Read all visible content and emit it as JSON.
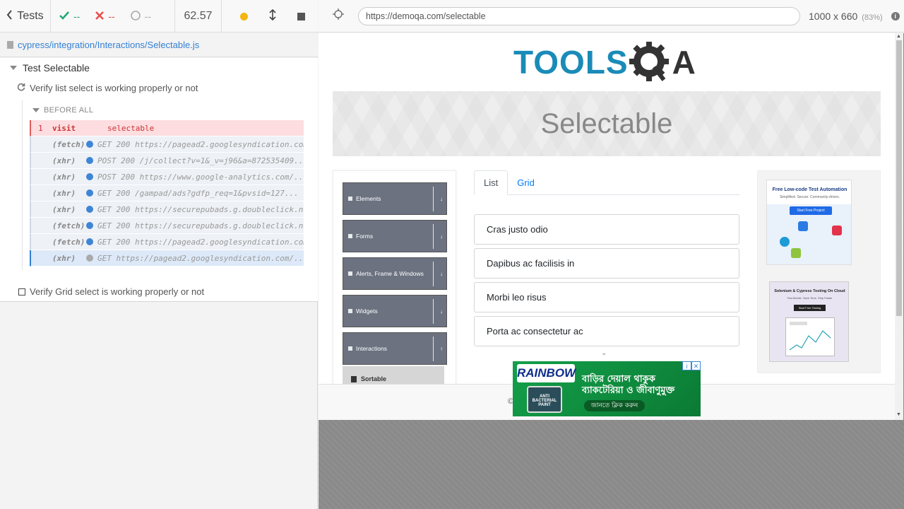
{
  "reporter": {
    "tests_label": "Tests",
    "passed": "--",
    "failed": "--",
    "pending": "--",
    "duration": "62.57",
    "spec_path": "cypress/integration/Interactions/Selectable.js",
    "suite_title": "Test Selectable",
    "test1_title": "Verify list select is working properly or not",
    "hook_title": "BEFORE ALL",
    "visit": {
      "num": "1",
      "name": "visit",
      "message": "selectable"
    },
    "commands": [
      {
        "name": "(fetch)",
        "message": "GET 200 https://pagead2.googlesyndication.com/..."
      },
      {
        "name": "(xhr)",
        "message": "POST 200 /j/collect?v=1&_v=j96&a=872535409..."
      },
      {
        "name": "(xhr)",
        "message": "POST 200 https://www.google-analytics.com/..."
      },
      {
        "name": "(xhr)",
        "message": "GET 200 /gampad/ads?gdfp_req=1&pvsid=127..."
      },
      {
        "name": "(xhr)",
        "message": "GET 200 https://securepubads.g.doubleclick.net/..."
      },
      {
        "name": "(fetch)",
        "message": "GET 200 https://securepubads.g.doubleclick.net/..."
      },
      {
        "name": "(fetch)",
        "message": "GET 200 https://pagead2.googlesyndication.com/..."
      }
    ],
    "pending_command": {
      "name": "(xhr)",
      "message": "GET https://pagead2.googlesyndication.com/..."
    },
    "test2_title": "Verify Grid select is working properly or not"
  },
  "aut": {
    "url": "https://demoqa.com/selectable",
    "viewport": "1000 x 660",
    "zoom": "(83%)",
    "logo_text": "TOOLS",
    "logo_suffix": "A",
    "page_title": "Selectable",
    "sidebar_groups": [
      {
        "label": "Elements"
      },
      {
        "label": "Forms"
      },
      {
        "label": "Alerts, Frame & Windows"
      },
      {
        "label": "Widgets"
      },
      {
        "label": "Interactions"
      }
    ],
    "sidebar_sub_item": "Sortable",
    "tabs": [
      {
        "label": "List",
        "active": true
      },
      {
        "label": "Grid",
        "active": false
      }
    ],
    "list_items": [
      "Cras justo odio",
      "Dapibus ac facilisis in",
      "Morbi leo risus",
      "Porta ac consectetur ac"
    ],
    "ad1": {
      "title": "Free Low-code Test Automation",
      "subtitle": "Simplified. Secure. Community-driven.",
      "cta": "Start Free Project"
    },
    "ad2": {
      "title": "Selenium & Cypress Testing On Cloud",
      "subtitle": "Test Mobile. Save Time. Ship Faster",
      "cta": "Start Free Testing"
    },
    "footer_left": "©",
    "footer_right": ".",
    "bottom_ad": {
      "brand": "RAINBOW",
      "badge": "ANTI BACTERIAL PAINT",
      "line1": "বাড়ির দেয়াল থাকুক",
      "line2": "ব্যাকটেরিয়া ও জীবাণুমুক্ত",
      "cta": "জানতে ক্লিক করুন"
    }
  },
  "colors": {
    "pass": "#1fa971",
    "fail": "#e94f4f",
    "link": "#3380d6",
    "logo_blue": "#1a8bb8",
    "sidebar_group": "#6c7280"
  }
}
